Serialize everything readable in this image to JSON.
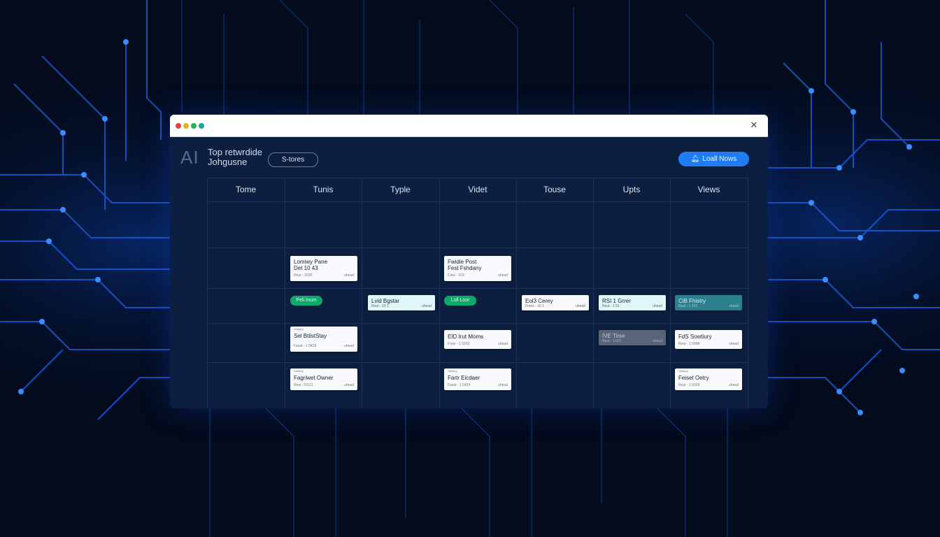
{
  "window": {
    "close_icon": "close-icon",
    "dot_colors": [
      "#e0443e",
      "#e2b21c",
      "#2bb24c",
      "#1aa39b"
    ]
  },
  "header": {
    "logo": "AI",
    "title_line1": "Top retwrdide",
    "title_line2": "Johgusne",
    "badge": "S-tores",
    "cta_icon": "bell-icon",
    "cta_label": "Loall Nows",
    "accent": "#1f7cf5"
  },
  "columns": [
    "Tome",
    "Tunis",
    "Typle",
    "Videt",
    "Touse",
    "Upts",
    "Views"
  ],
  "cards": {
    "tunis_1": {
      "line1": "Lomiwy Pane",
      "line2": "Det 10 43",
      "meta": "Reut - 2028",
      "meta2": "uhead"
    },
    "videt_1": {
      "line1": "Fwidie Post",
      "line2": "Fest Fshdany",
      "meta": "Cisw - 103",
      "meta2": "uhead"
    },
    "tunis_pill": {
      "label": "Peli Inum"
    },
    "typle_chip": {
      "line1": "Lvid Bgstar",
      "meta": "Reut - 10 1",
      "meta2": "uhead"
    },
    "videt_pill": {
      "label": "Loll Loor"
    },
    "touse_chip": {
      "line1": "Eol3 Cerey",
      "meta": "Frees - 10 1",
      "meta2": "uhead"
    },
    "upts_chip": {
      "line1": "RSI 1 Grrer",
      "meta": "Reut - 1 01",
      "meta2": "uhead"
    },
    "views_chip": {
      "line1": "CiB Fhistry",
      "meta": "Reut - 1 101",
      "meta2": "uhead"
    },
    "tunis_2": {
      "tag": "Hastery",
      "line1": "Sel BtilstStay",
      "meta": "Fasat - 1 0428",
      "meta2": "uhead"
    },
    "videt_2": {
      "line1": "EID Irut Moms",
      "meta": "Fresr - 1 5303",
      "meta2": "uhead"
    },
    "upts_grey": {
      "line1": "IVE Tirse",
      "meta": "Reut - 1 001",
      "meta2": "uhead"
    },
    "views_2": {
      "line1": "FdS Sowtiury",
      "meta": "Reut - 1 6098",
      "meta2": "uhead"
    },
    "tunis_3": {
      "tag": "Hastery",
      "line1": "Fagriwet Owner",
      "meta": "Reut - FG21",
      "meta2": "uhead"
    },
    "videt_3": {
      "tag": "Hastery",
      "line1": "Fartr Eicdaer",
      "meta": "Fasat - 1 5434",
      "meta2": "uhead"
    },
    "views_3": {
      "tag": "Hastery",
      "line1": "Feiset Oetry",
      "meta": "Reut - 1 6028",
      "meta2": "uhead"
    }
  },
  "colors": {
    "pill_green": "#0ea86d",
    "chip_cyan": "#dff7f8",
    "chip_teal": "#2c7f8e",
    "chip_grey": "#5a6479"
  }
}
